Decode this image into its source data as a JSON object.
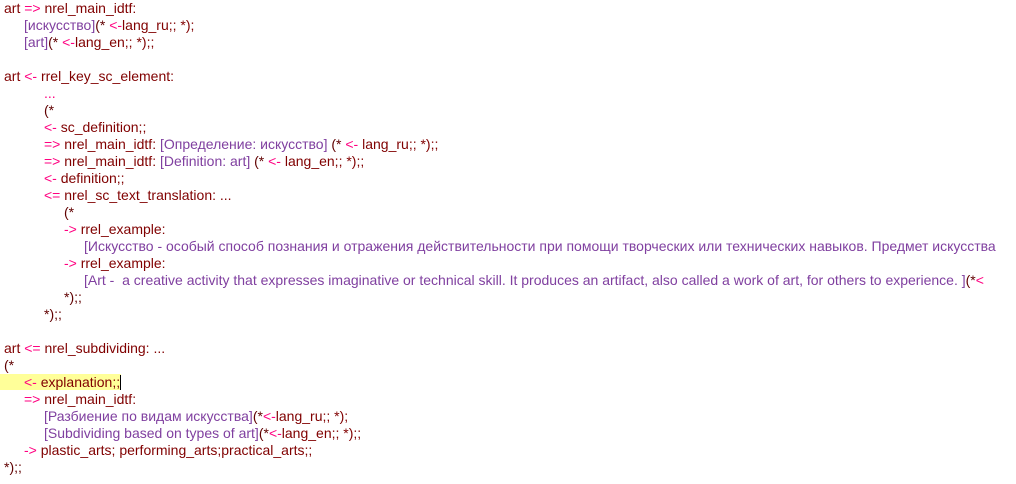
{
  "editor": {
    "highlighted_line": 22,
    "lines": [
      {
        "indent": 0,
        "seg": [
          [
            "k",
            "art "
          ],
          [
            "a",
            "=> "
          ],
          [
            "k",
            "nrel_main_idtf:"
          ]
        ]
      },
      {
        "indent": 1,
        "seg": [
          [
            "c",
            "[искусство]"
          ],
          [
            "p",
            "(* "
          ],
          [
            "a",
            "<-"
          ],
          [
            "k",
            "lang_ru;; *);"
          ]
        ]
      },
      {
        "indent": 1,
        "seg": [
          [
            "c",
            "[art]"
          ],
          [
            "p",
            "(* "
          ],
          [
            "a",
            "<-"
          ],
          [
            "k",
            "lang_en;; *);;"
          ]
        ]
      },
      {
        "indent": 0,
        "seg": []
      },
      {
        "indent": 0,
        "seg": [
          [
            "k",
            "art "
          ],
          [
            "a",
            "<- "
          ],
          [
            "k",
            "rrel_key_sc_element:"
          ]
        ]
      },
      {
        "indent": 2,
        "seg": [
          [
            "a",
            "..."
          ]
        ]
      },
      {
        "indent": 2,
        "seg": [
          [
            "p",
            "(*"
          ]
        ]
      },
      {
        "indent": 2,
        "seg": [
          [
            "a",
            "<- "
          ],
          [
            "k",
            "sc_definition;;"
          ]
        ]
      },
      {
        "indent": 2,
        "seg": [
          [
            "a",
            "=> "
          ],
          [
            "k",
            "nrel_main_idtf: "
          ],
          [
            "c",
            "[Определение: искусство]"
          ],
          [
            "p",
            " (* "
          ],
          [
            "a",
            "<- "
          ],
          [
            "k",
            "lang_ru;; *);;"
          ]
        ]
      },
      {
        "indent": 2,
        "seg": [
          [
            "a",
            "=> "
          ],
          [
            "k",
            "nrel_main_idtf: "
          ],
          [
            "c",
            "[Definition: art]"
          ],
          [
            "p",
            " (* "
          ],
          [
            "a",
            "<- "
          ],
          [
            "k",
            "lang_en;; *);;"
          ]
        ]
      },
      {
        "indent": 2,
        "seg": [
          [
            "a",
            "<- "
          ],
          [
            "k",
            "definition;;"
          ]
        ]
      },
      {
        "indent": 2,
        "seg": [
          [
            "a",
            "<= "
          ],
          [
            "k",
            "nrel_sc_text_translation: ..."
          ]
        ]
      },
      {
        "indent": 3,
        "seg": [
          [
            "p",
            "(*"
          ]
        ]
      },
      {
        "indent": 3,
        "seg": [
          [
            "a",
            "-> "
          ],
          [
            "k",
            "rrel_example:"
          ]
        ]
      },
      {
        "indent": 4,
        "seg": [
          [
            "c",
            "[Искусство - особый способ познания и отражения действительности при помощи творческих или технических навыков. Предмет искусства"
          ]
        ]
      },
      {
        "indent": 3,
        "seg": [
          [
            "a",
            "-> "
          ],
          [
            "k",
            "rrel_example:"
          ]
        ]
      },
      {
        "indent": 4,
        "seg": [
          [
            "c",
            "[Art -  a creative activity that expresses imaginative or technical skill. It produces an artifact, also called a work of art, for others to experience. ]"
          ],
          [
            "p",
            "(*"
          ],
          [
            "a",
            "<"
          ]
        ]
      },
      {
        "indent": 3,
        "seg": [
          [
            "p",
            "*);;"
          ]
        ]
      },
      {
        "indent": 2,
        "seg": [
          [
            "p",
            "*);;"
          ]
        ]
      },
      {
        "indent": 0,
        "seg": []
      },
      {
        "indent": 0,
        "seg": [
          [
            "k",
            "art "
          ],
          [
            "a",
            "<= "
          ],
          [
            "k",
            "nrel_subdividing: ..."
          ]
        ]
      },
      {
        "indent": 0,
        "seg": [
          [
            "p",
            "(*"
          ]
        ]
      },
      {
        "indent": 1,
        "seg": [
          [
            "a",
            "<- "
          ],
          [
            "k",
            "explanation;;"
          ]
        ]
      },
      {
        "indent": 1,
        "seg": [
          [
            "a",
            "=> "
          ],
          [
            "k",
            "nrel_main_idtf:"
          ]
        ]
      },
      {
        "indent": 2,
        "seg": [
          [
            "c",
            "[Разбиение по видам искусства]"
          ],
          [
            "p",
            "(*"
          ],
          [
            "a",
            "<-"
          ],
          [
            "k",
            "lang_ru;; *);"
          ]
        ]
      },
      {
        "indent": 2,
        "seg": [
          [
            "c",
            "[Subdividing based on types of art]"
          ],
          [
            "p",
            "(*"
          ],
          [
            "a",
            "<-"
          ],
          [
            "k",
            "lang_en;; *);;"
          ]
        ]
      },
      {
        "indent": 1,
        "seg": [
          [
            "a",
            "-> "
          ],
          [
            "k",
            "plastic_arts; performing_arts;practical_arts;;"
          ]
        ]
      },
      {
        "indent": 0,
        "seg": [
          [
            "p",
            "*);;"
          ]
        ]
      }
    ]
  }
}
